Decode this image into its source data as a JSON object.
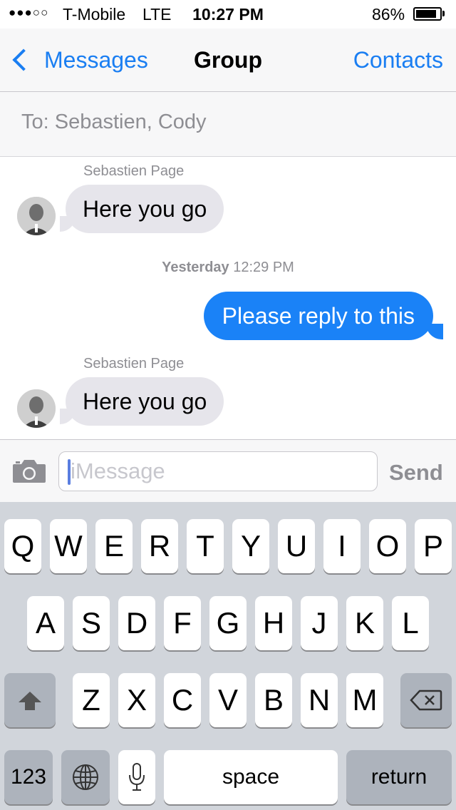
{
  "status_bar": {
    "signal": "●●●○○",
    "carrier": "T-Mobile",
    "network": "LTE",
    "time": "10:27 PM",
    "battery_percent": "86%",
    "battery_level": 0.86
  },
  "nav": {
    "back_label": "Messages",
    "title": "Group",
    "right_label": "Contacts"
  },
  "recipients": {
    "text": "To: Sebastien, Cody"
  },
  "conversation": {
    "messages": [
      {
        "sender": "Sebastien Page",
        "text": "Here you go",
        "direction": "incoming"
      },
      {
        "text": "Please reply to this",
        "direction": "outgoing"
      },
      {
        "sender": "Sebastien Page",
        "text": "Here you go",
        "direction": "incoming"
      }
    ],
    "timestamp_day": "Yesterday",
    "timestamp_time": "12:29 PM"
  },
  "input": {
    "placeholder": "iMessage",
    "send_label": "Send",
    "camera_icon": "camera-icon"
  },
  "keyboard": {
    "row1": [
      "Q",
      "W",
      "E",
      "R",
      "T",
      "Y",
      "U",
      "I",
      "O",
      "P"
    ],
    "row2": [
      "A",
      "S",
      "D",
      "F",
      "G",
      "H",
      "J",
      "K",
      "L"
    ],
    "row3": [
      "Z",
      "X",
      "C",
      "V",
      "B",
      "N",
      "M"
    ],
    "numbers_label": "123",
    "space_label": "space",
    "return_label": "return",
    "shift_icon": "shift-icon",
    "delete_icon": "delete-icon",
    "globe_icon": "globe-icon",
    "mic_icon": "microphone-icon"
  },
  "colors": {
    "accent": "#1a7ef2",
    "outgoing_bubble": "#1a82f7",
    "incoming_bubble": "#e6e5eb",
    "keyboard_bg": "#d1d5db"
  }
}
